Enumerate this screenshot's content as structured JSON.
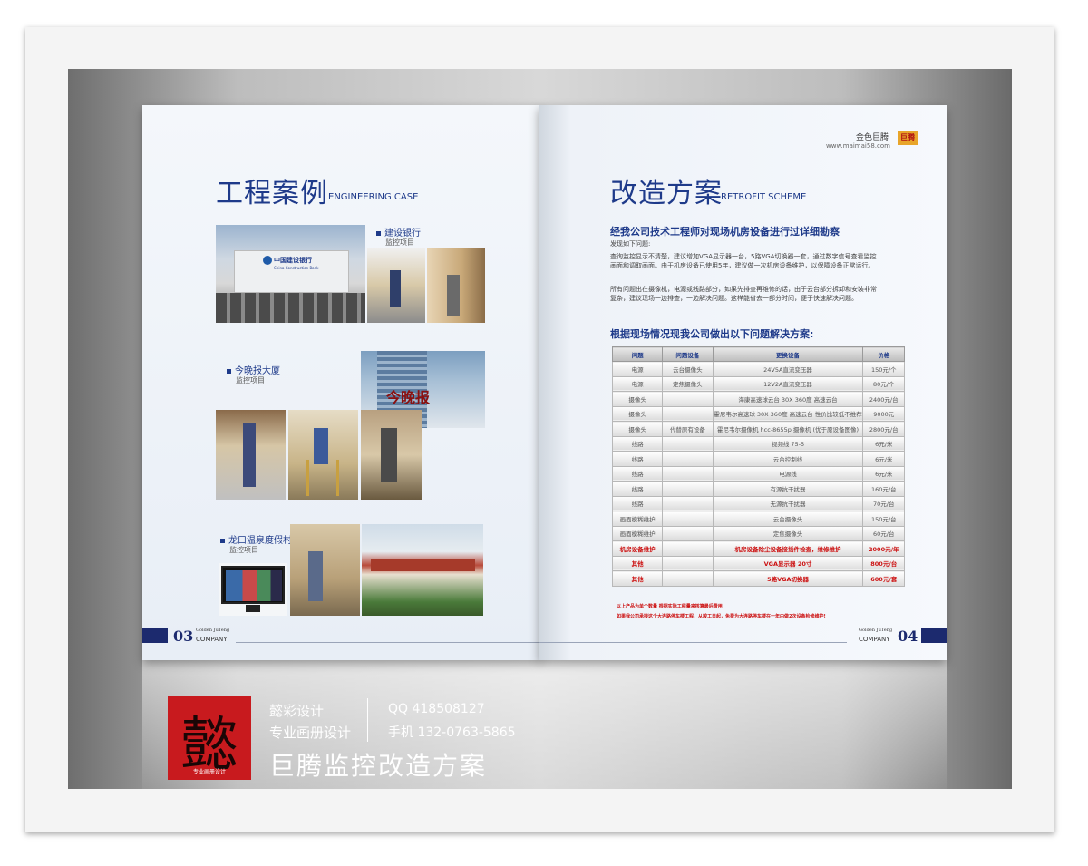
{
  "left_page": {
    "title_cn": "工程案例",
    "title_en": "ENGINEERING CASE",
    "projects": [
      {
        "name": "建设银行",
        "sub": "监控项目"
      },
      {
        "name": "今晚报大厦",
        "sub": "监控项目"
      },
      {
        "name": "龙口温泉度假村",
        "sub": "监控项目"
      }
    ],
    "bank_sign_cn": "中国建设银行",
    "bank_sign_en": "China Construction Bank",
    "building_sign": "今晚报",
    "page_number": "03",
    "footer_brand_1": "Golden",
    "footer_brand_2": "JuTeng",
    "footer_company": "COMPANY"
  },
  "right_page": {
    "brand_name": "金色巨腾",
    "brand_url": "www.maimai58.com",
    "brand_logo_text": "巨腾",
    "title_cn": "改造方案",
    "title_en": "RETROFIT SCHEME",
    "heading1": "经我公司技术工程师对现场机房设备进行过详细勘察",
    "intro_label": "发现如下问题:",
    "para1": "查询监控显示不清楚，建议增加VGA显示器一台，5路VGA切换器一套，通过数字信号查看监控画面和调取画面。由于机房设备已使用5年，建议做一次机房设备维护，以保障设备正常运行。",
    "para2": "所有问题出在摄像机，电源或线路部分，如果先排查再维修的话，由于云台部分拆卸和安装非常复杂，建议现场一边排查，一边解决问题。这样能省去一部分时间，便于快速解决问题。",
    "heading2": "根据现场情况现我公司做出以下问题解决方案:",
    "table": {
      "headers": [
        "问题",
        "问题设备",
        "更换设备",
        "价格"
      ],
      "rows": [
        [
          "电源",
          "云台摄像头",
          "24V5A直流变压器",
          "150元/个"
        ],
        [
          "电源",
          "定焦摄像头",
          "12V2A直流变压器",
          "80元/个"
        ],
        [
          "摄像头",
          "",
          "海康高速球云台  30X 360度 高速云台",
          "2400元/台"
        ],
        [
          "摄像头",
          "",
          "霍尼韦尔高速球  30X 360度 高速云台 性价比较低不推荐",
          "9000元"
        ],
        [
          "摄像头",
          "代替原有设备",
          "霍尼韦尔摄像机  hcc-8655p 摄像机 (优于原设备图像)",
          "2800元/台"
        ],
        [
          "线路",
          "",
          "视频线  75-5",
          "6元/米"
        ],
        [
          "线路",
          "",
          "云台控制线",
          "6元/米"
        ],
        [
          "线路",
          "",
          "电源线",
          "6元/米"
        ],
        [
          "线路",
          "",
          "有源抗干扰器",
          "160元/台"
        ],
        [
          "线路",
          "",
          "无源抗干扰器",
          "70元/台"
        ],
        [
          "画面模糊维护",
          "",
          "云台摄像头",
          "150元/台"
        ],
        [
          "画面模糊维护",
          "",
          "定焦摄像头",
          "60元/台"
        ],
        [
          "机房设备维护",
          "",
          "机房设备除尘设备接插件检查，维修维护",
          "2000元/年"
        ],
        [
          "其他",
          "",
          "VGA显示器 20寸",
          "800元/台"
        ],
        [
          "其他",
          "",
          "5路VGA切换器",
          "600元/套"
        ]
      ],
      "highlight_rows": [
        12,
        13,
        14
      ]
    },
    "note1": "以上产品为单个数量 根据实际工程量来核算最后费用",
    "note2": "如果我公司承接这个大连路停车楼工程，从竣工日起，免费为大连路停车楼在一年内做2次设备检修维护!",
    "page_number": "04",
    "footer_brand_1": "Golden",
    "footer_brand_2": "JuTeng",
    "footer_company": "COMPANY"
  },
  "promo": {
    "logo_char": "懿",
    "logo_sub": "专业画册设计",
    "line1": "懿彩设计",
    "line2": "专业画册设计",
    "qq": "QQ 418508127",
    "phone": "手机 132-0763-5865",
    "title": "巨腾监控改造方案"
  }
}
